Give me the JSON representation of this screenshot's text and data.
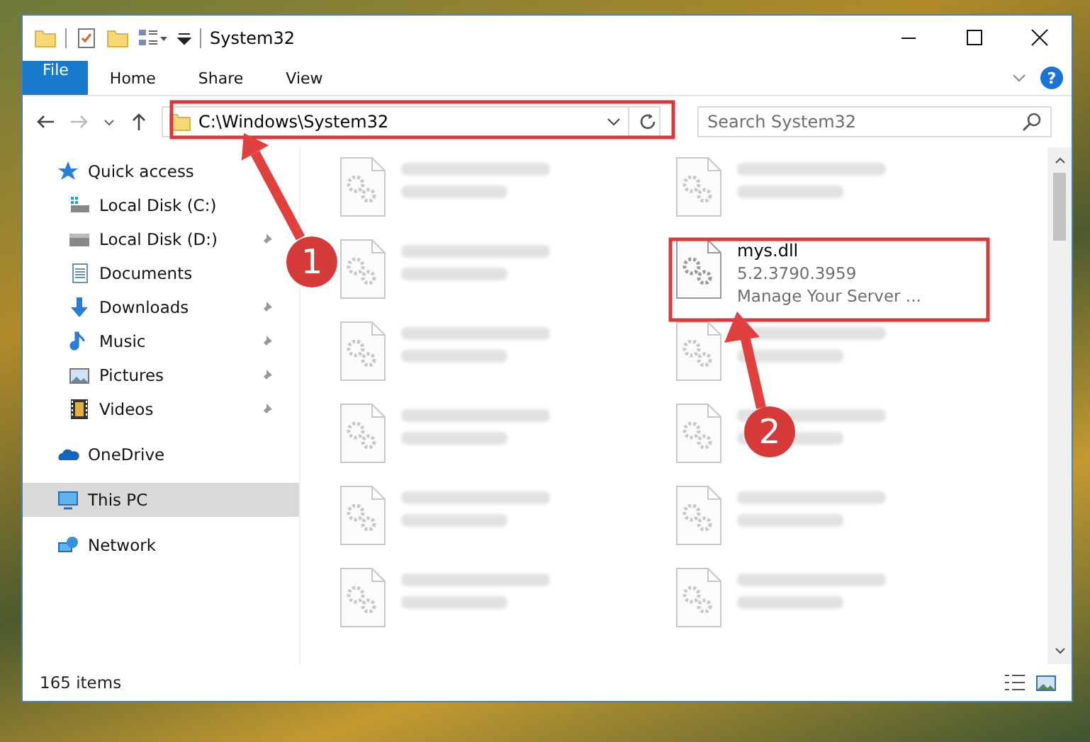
{
  "window": {
    "title": "System32"
  },
  "ribbon_tabs": [
    {
      "label": "File",
      "kind": "file"
    },
    {
      "label": "Home",
      "kind": "tab"
    },
    {
      "label": "Share",
      "kind": "tab"
    },
    {
      "label": "View",
      "kind": "tab"
    }
  ],
  "help_button": {
    "label": "?"
  },
  "address_bar": {
    "path": "C:\\Windows\\System32"
  },
  "search": {
    "placeholder": "Search System32"
  },
  "sidebar": {
    "items": [
      {
        "label": "Quick access",
        "kind": "quick",
        "selected": false,
        "children": [
          {
            "label": "Local Disk (C:)",
            "kind": "sysdisk",
            "pinned": false,
            "selected": false
          },
          {
            "label": "Local Disk (D:)",
            "kind": "disk",
            "pinned": true,
            "selected": false
          },
          {
            "label": "Documents",
            "kind": "documents",
            "pinned": false,
            "selected": false
          },
          {
            "label": "Downloads",
            "kind": "downloads",
            "pinned": true,
            "selected": false
          },
          {
            "label": "Music",
            "kind": "music",
            "pinned": true,
            "selected": false
          },
          {
            "label": "Pictures",
            "kind": "pictures",
            "pinned": true,
            "selected": false
          },
          {
            "label": "Videos",
            "kind": "videos",
            "pinned": true,
            "selected": false
          }
        ]
      },
      {
        "label": "OneDrive",
        "kind": "cloud",
        "selected": false
      },
      {
        "label": "This PC",
        "kind": "pc",
        "selected": true
      },
      {
        "label": "Network",
        "kind": "network",
        "selected": false
      }
    ]
  },
  "files": [
    {
      "blurred": true
    },
    {
      "blurred": true
    },
    {
      "blurred": true
    },
    {
      "lines": [
        "mys.dll",
        "5.2.3790.3959",
        "Manage Your Server ..."
      ],
      "blurred": false
    },
    {
      "blurred": true
    },
    {
      "blurred": true
    },
    {
      "blurred": true
    },
    {
      "blurred": true
    },
    {
      "blurred": true
    },
    {
      "blurred": true
    },
    {
      "blurred": true
    },
    {
      "blurred": true
    }
  ],
  "status_bar": {
    "text": "165 items"
  },
  "callouts": [
    {
      "number": "1"
    },
    {
      "number": "2"
    }
  ]
}
